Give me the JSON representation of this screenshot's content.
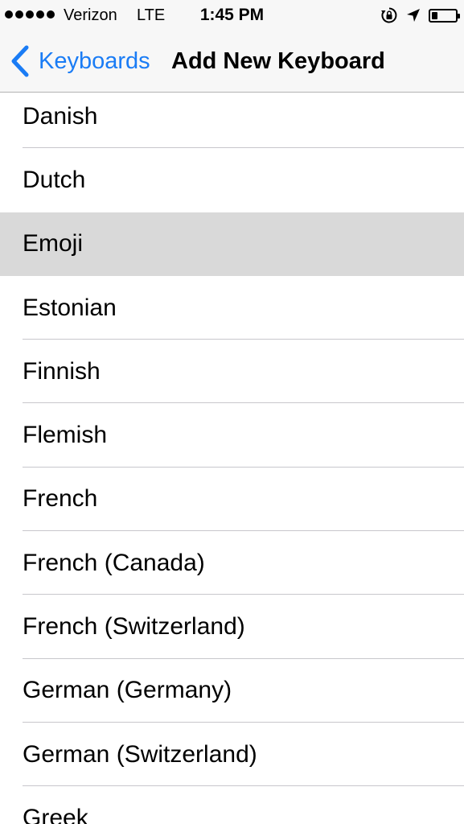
{
  "status_bar": {
    "carrier": "Verizon",
    "network": "LTE",
    "time": "1:45 PM",
    "icons": [
      "rotation-lock-icon",
      "location-arrow-icon",
      "battery-icon"
    ],
    "battery_level": 0.25
  },
  "nav": {
    "back_label": "Keyboards",
    "title": "Add New Keyboard"
  },
  "keyboards": [
    {
      "label": "Danish"
    },
    {
      "label": "Dutch"
    },
    {
      "label": "Emoji"
    },
    {
      "label": "Estonian"
    },
    {
      "label": "Finnish"
    },
    {
      "label": "Flemish"
    },
    {
      "label": "French"
    },
    {
      "label": "French (Canada)"
    },
    {
      "label": "French (Switzerland)"
    },
    {
      "label": "German (Germany)"
    },
    {
      "label": "German (Switzerland)"
    },
    {
      "label": "Greek"
    }
  ],
  "selected_keyboard": "Emoji",
  "colors": {
    "accent": "#1a7cf5",
    "highlight": "#d9d9d9",
    "separator": "#c8c7cc"
  }
}
